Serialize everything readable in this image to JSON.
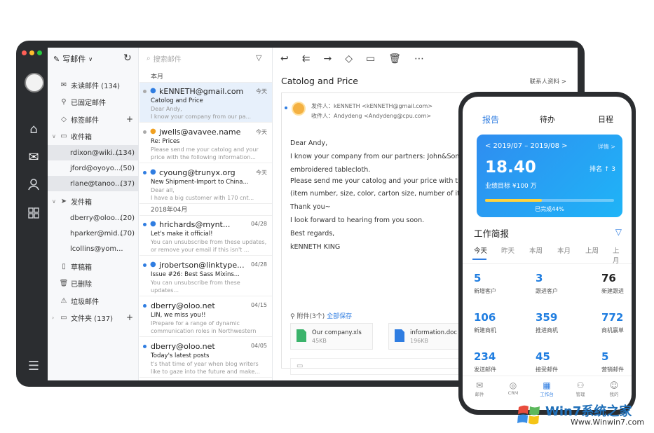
{
  "window_dots": [
    "#ff5f56",
    "#ffbd2e",
    "#27c93f"
  ],
  "folders": {
    "compose_label": "写邮件",
    "items": [
      {
        "label": "未读邮件 (134)",
        "icon": "mail-icon"
      },
      {
        "label": "已固定邮件",
        "icon": "pin-icon"
      },
      {
        "label": "标签邮件",
        "icon": "tag-icon"
      },
      {
        "label": "收件箱",
        "icon": "inbox-icon"
      },
      {
        "label": "rdixon@wiki...",
        "count": "(134)"
      },
      {
        "label": "jford@oyoyo...",
        "count": "(50)"
      },
      {
        "label": "rlane@tanoo...",
        "count": "(37)"
      },
      {
        "label": "发件箱",
        "icon": "send-icon"
      },
      {
        "label": "dberry@oloo...",
        "count": "(20)"
      },
      {
        "label": "hparker@mid...",
        "count": "(70)"
      },
      {
        "label": "lcollins@yom...",
        "count": ""
      },
      {
        "label": "草稿箱",
        "icon": "draft-icon"
      },
      {
        "label": "已删除",
        "icon": "trash-icon"
      },
      {
        "label": "垃圾邮件",
        "icon": "spam-icon"
      },
      {
        "label": "文件夹 (137)",
        "icon": "folder-icon"
      }
    ]
  },
  "list": {
    "search_placeholder": "搜索邮件",
    "section_month": "本月",
    "section_april": "2018年04月",
    "messages": [
      {
        "from": "kENNETH@gmail.com",
        "date": "今天",
        "subject": "Catolog and  Price",
        "preview": "Dear Andy,\nI know your company from our pa..."
      },
      {
        "from": "jwells@avavee.name",
        "date": "今天",
        "subject": "Re: Prices",
        "preview": "Please send me your catolog and your price with the following information..."
      },
      {
        "from": "cyoung@trunyx.org",
        "date": "今天",
        "subject": "New Shipment-Import to China...",
        "preview": "Dear all,\nI have a big customer with 170 cnt..."
      },
      {
        "from": "hrichards@mynt...",
        "date": "04/28",
        "subject": "Let's make it official!",
        "preview": "You can unsubscribe from these updates, or remove your email if this isn't ..."
      },
      {
        "from": "jrobertson@linktype...",
        "date": "04/28",
        "subject": "Issue #26: Best Sass Mixins...",
        "preview": "You can unsubscribe from these updates..."
      },
      {
        "from": "dberry@oloo.net",
        "date": "04/15",
        "subject": "LIN, we miss you!!",
        "preview": "IPrepare for a range of dynamic communication roles in Northwestern Univer..."
      },
      {
        "from": "dberry@oloo.net",
        "date": "04/05",
        "subject": "Today's latest posts",
        "preview": "t's that time of year when blog writers like to gaze into the future and make..."
      }
    ]
  },
  "reader": {
    "title": "Catolog and  Price",
    "contact_link": "联系人资料 >",
    "from_label": "发件人：",
    "from_value": "kENNETH <kENNETH@gmail.com>",
    "to_label": "收件人：",
    "to_value": "Andydeng <Andydeng@cpu.com>",
    "body": [
      "Dear Andy,",
      "I know your company from our partners: John&Son C",
      "embroidered tablecloth.",
      "Please send me your catolog and your price with the f",
      "(item number, size, color, carton size, number of item",
      "Thank you~",
      "I look forward to hearing from you soon.",
      "Best regards,",
      "kENNETH KING"
    ],
    "attach_label": "附件(3个)",
    "attach_save": "全部保存",
    "attachments": [
      {
        "name": "Our company.xls",
        "size": "45KB",
        "color": "#3bb36b"
      },
      {
        "name": "information.doc",
        "size": "196KB",
        "color": "#2f7de1"
      }
    ]
  },
  "phone": {
    "tabs": [
      "报告",
      "待办",
      "日程"
    ],
    "range": "< 2019/07 – 2019/08 >",
    "detail": "详情 >",
    "big_value": "18.40",
    "rank": "排名 ↑ 3",
    "goal": "业绩目标 ¥100 万",
    "progress": 0.44,
    "done_label": "已完成44%",
    "report_title": "工作简报",
    "days": [
      "今天",
      "昨天",
      "本周",
      "本月",
      "上周",
      "上月"
    ],
    "stats": [
      {
        "value": "5",
        "label": "新增客户"
      },
      {
        "value": "3",
        "label": "跟进客户"
      },
      {
        "value": "76",
        "label": "新建跟进"
      },
      {
        "value": "106",
        "label": "新建商机"
      },
      {
        "value": "359",
        "label": "推进商机"
      },
      {
        "value": "772",
        "label": "商机赢单"
      },
      {
        "value": "234",
        "label": "发送邮件"
      },
      {
        "value": "45",
        "label": "接受邮件"
      },
      {
        "value": "5",
        "label": "营销邮件"
      }
    ],
    "nav": [
      {
        "label": "邮件",
        "icon": "mail-icon"
      },
      {
        "label": "CRM",
        "icon": "crm-icon"
      },
      {
        "label": "工作台",
        "icon": "workbench-icon"
      },
      {
        "label": "管理",
        "icon": "org-icon"
      },
      {
        "label": "我的",
        "icon": "me-icon"
      }
    ]
  },
  "watermark": {
    "brand": "Win7系统之家",
    "url": "Www.Winwin7.com"
  }
}
